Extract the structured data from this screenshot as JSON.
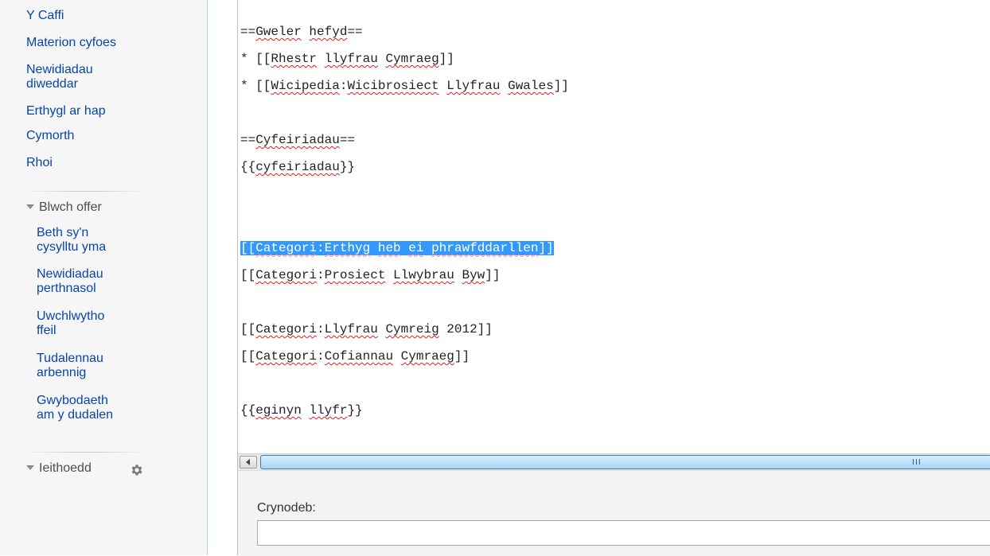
{
  "sidebar": {
    "nav": {
      "cafe": "Y Caffi",
      "current_events": "Materion cyfoes",
      "recent_changes_1": "Newidiadau",
      "recent_changes_2": "diweddar",
      "random_article": "Erthygl ar hap",
      "help": "Cymorth",
      "donate": "Rhoi"
    },
    "toolbox": {
      "heading": "Blwch offer",
      "what_links_1": "Beth sy'n",
      "what_links_2": "cysylltu yma",
      "related_1": "Newidiadau",
      "related_2": "perthnasol",
      "upload_1": "Uwchlwytho",
      "upload_2": "ffeil",
      "special_1": "Tudalennau",
      "special_2": "arbennig",
      "page_info_1": "Gwybodaeth",
      "page_info_2": "am y dudalen"
    },
    "languages": {
      "heading": "Ieithoedd",
      "gear_icon": "gear-icon"
    }
  },
  "editor": {
    "lines": [
      "==Gweler hefyd==",
      "* [[Rhestr llyfrau Cymraeg]]",
      "* [[Wicipedia:Wicibrosiect Llyfrau Gwales]]",
      "",
      "==Cyfeiriadau==",
      "{{cyfeiriadau}}",
      "",
      "",
      "[[Categori:Erthyg heb ei phrawfddarllen]]",
      "[[Categori:Prosiect Llwybrau Byw]]",
      "",
      "[[Categori:Llyfrau Cymreig 2012]]",
      "[[Categori:Cofiannau Cymraeg]]",
      "",
      "{{eginyn llyfr}}"
    ],
    "selected_line_index": 8,
    "selection_color": "#3399ff"
  },
  "scrollbar": {
    "grip": "III"
  },
  "summary": {
    "label": "Crynodeb:",
    "value": "",
    "placeholder": ""
  },
  "colors": {
    "link": "#0645ad",
    "sidebar_bg": "#f6f6f6",
    "spellcheck_underline": "#e02020"
  }
}
